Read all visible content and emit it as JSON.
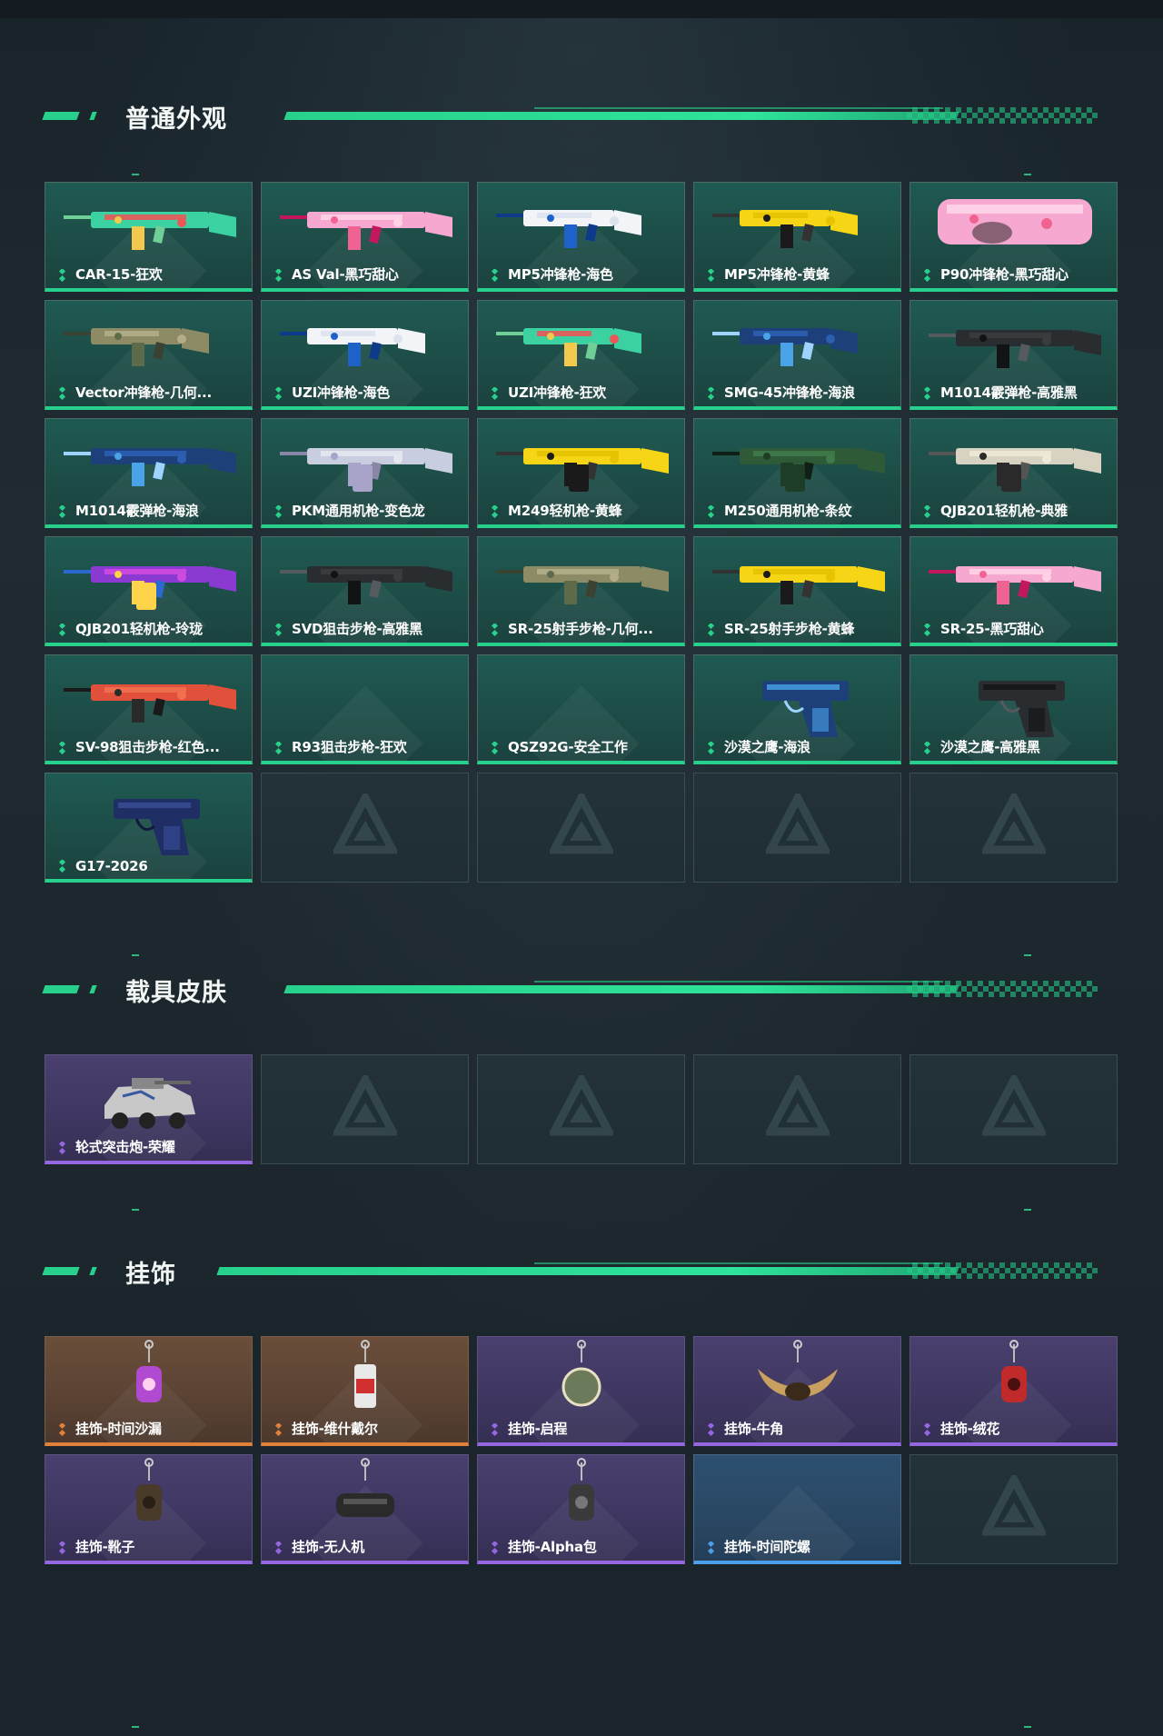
{
  "sections": [
    {
      "title": "普通外观",
      "items": [
        {
          "label": "CAR-15-狂欢",
          "rarity": "green",
          "icon": "rifle-carnival"
        },
        {
          "label": "AS Val-黑巧甜心",
          "rarity": "green",
          "icon": "rifle-pink"
        },
        {
          "label": "MP5冲锋枪-海色",
          "rarity": "green",
          "icon": "smg-white-blue"
        },
        {
          "label": "MP5冲锋枪-黄蜂",
          "rarity": "green",
          "icon": "smg-yellow"
        },
        {
          "label": "P90冲锋枪-黑巧甜心",
          "rarity": "green",
          "icon": "smg-pink"
        },
        {
          "label": "Vector冲锋枪-几何...",
          "rarity": "green",
          "icon": "smg-camo"
        },
        {
          "label": "UZI冲锋枪-海色",
          "rarity": "green",
          "icon": "smg-white-blue"
        },
        {
          "label": "UZI冲锋枪-狂欢",
          "rarity": "green",
          "icon": "smg-carnival"
        },
        {
          "label": "SMG-45冲锋枪-海浪",
          "rarity": "green",
          "icon": "smg-wave"
        },
        {
          "label": "M1014霰弹枪-高雅黑",
          "rarity": "green",
          "icon": "shotgun-black"
        },
        {
          "label": "M1014霰弹枪-海浪",
          "rarity": "green",
          "icon": "shotgun-wave"
        },
        {
          "label": "PKM通用机枪-变色龙",
          "rarity": "green",
          "icon": "mg-chameleon"
        },
        {
          "label": "M249轻机枪-黄蜂",
          "rarity": "green",
          "icon": "mg-yellow"
        },
        {
          "label": "M250通用机枪-条纹",
          "rarity": "green",
          "icon": "mg-green"
        },
        {
          "label": "QJB201轻机枪-典雅",
          "rarity": "green",
          "icon": "mg-elegant"
        },
        {
          "label": "QJB201轻机枪-玲珑",
          "rarity": "green",
          "icon": "mg-purple"
        },
        {
          "label": "SVD狙击步枪-高雅黑",
          "rarity": "green",
          "icon": "sniper-black"
        },
        {
          "label": "SR-25射手步枪-几何...",
          "rarity": "green",
          "icon": "rifle-camo"
        },
        {
          "label": "SR-25射手步枪-黄蜂",
          "rarity": "green",
          "icon": "rifle-yellow"
        },
        {
          "label": "SR-25-黑巧甜心",
          "rarity": "green",
          "icon": "rifle-pink"
        },
        {
          "label": "SV-98狙击步枪-红色...",
          "rarity": "green",
          "icon": "sniper-red"
        },
        {
          "label": "R93狙击步枪-狂欢",
          "rarity": "green",
          "icon": ""
        },
        {
          "label": "QSZ92G-安全工作",
          "rarity": "green",
          "icon": ""
        },
        {
          "label": "沙漠之鹰-海浪",
          "rarity": "green",
          "icon": "pistol-wave"
        },
        {
          "label": "沙漠之鹰-高雅黑",
          "rarity": "green",
          "icon": "pistol-black"
        },
        {
          "label": "G17-2026",
          "rarity": "green",
          "icon": "pistol-navy"
        },
        {
          "label": "",
          "rarity": "empty"
        },
        {
          "label": "",
          "rarity": "empty"
        },
        {
          "label": "",
          "rarity": "empty"
        },
        {
          "label": "",
          "rarity": "empty"
        }
      ]
    },
    {
      "title": "载具皮肤",
      "items": [
        {
          "label": "轮式突击炮-荣耀",
          "rarity": "purple",
          "icon": "vehicle"
        },
        {
          "label": "",
          "rarity": "empty"
        },
        {
          "label": "",
          "rarity": "empty"
        },
        {
          "label": "",
          "rarity": "empty"
        },
        {
          "label": "",
          "rarity": "empty"
        }
      ]
    },
    {
      "title": "挂饰",
      "items": [
        {
          "label": "挂饰-时间沙漏",
          "rarity": "orange",
          "icon": "charm-hourglass"
        },
        {
          "label": "挂饰-维什戴尔",
          "rarity": "orange",
          "icon": "charm-bottle"
        },
        {
          "label": "挂饰-启程",
          "rarity": "purple",
          "icon": "charm-badge"
        },
        {
          "label": "挂饰-牛角",
          "rarity": "purple",
          "icon": "charm-horn"
        },
        {
          "label": "挂饰-绒花",
          "rarity": "purple",
          "icon": "charm-flower"
        },
        {
          "label": "挂饰-靴子",
          "rarity": "purple",
          "icon": "charm-boot"
        },
        {
          "label": "挂饰-无人机",
          "rarity": "purple",
          "icon": "charm-drone"
        },
        {
          "label": "挂饰-Alpha包",
          "rarity": "purple",
          "icon": "charm-bag"
        },
        {
          "label": "挂饰-时间陀螺",
          "rarity": "blue",
          "icon": ""
        },
        {
          "label": "",
          "rarity": "empty"
        }
      ]
    }
  ],
  "colors": {
    "accent": "#27d18b",
    "green_rarity": "#27d18b",
    "purple_rarity": "#9467e0",
    "orange_rarity": "#e0803a",
    "blue_rarity": "#4a9fe8"
  }
}
